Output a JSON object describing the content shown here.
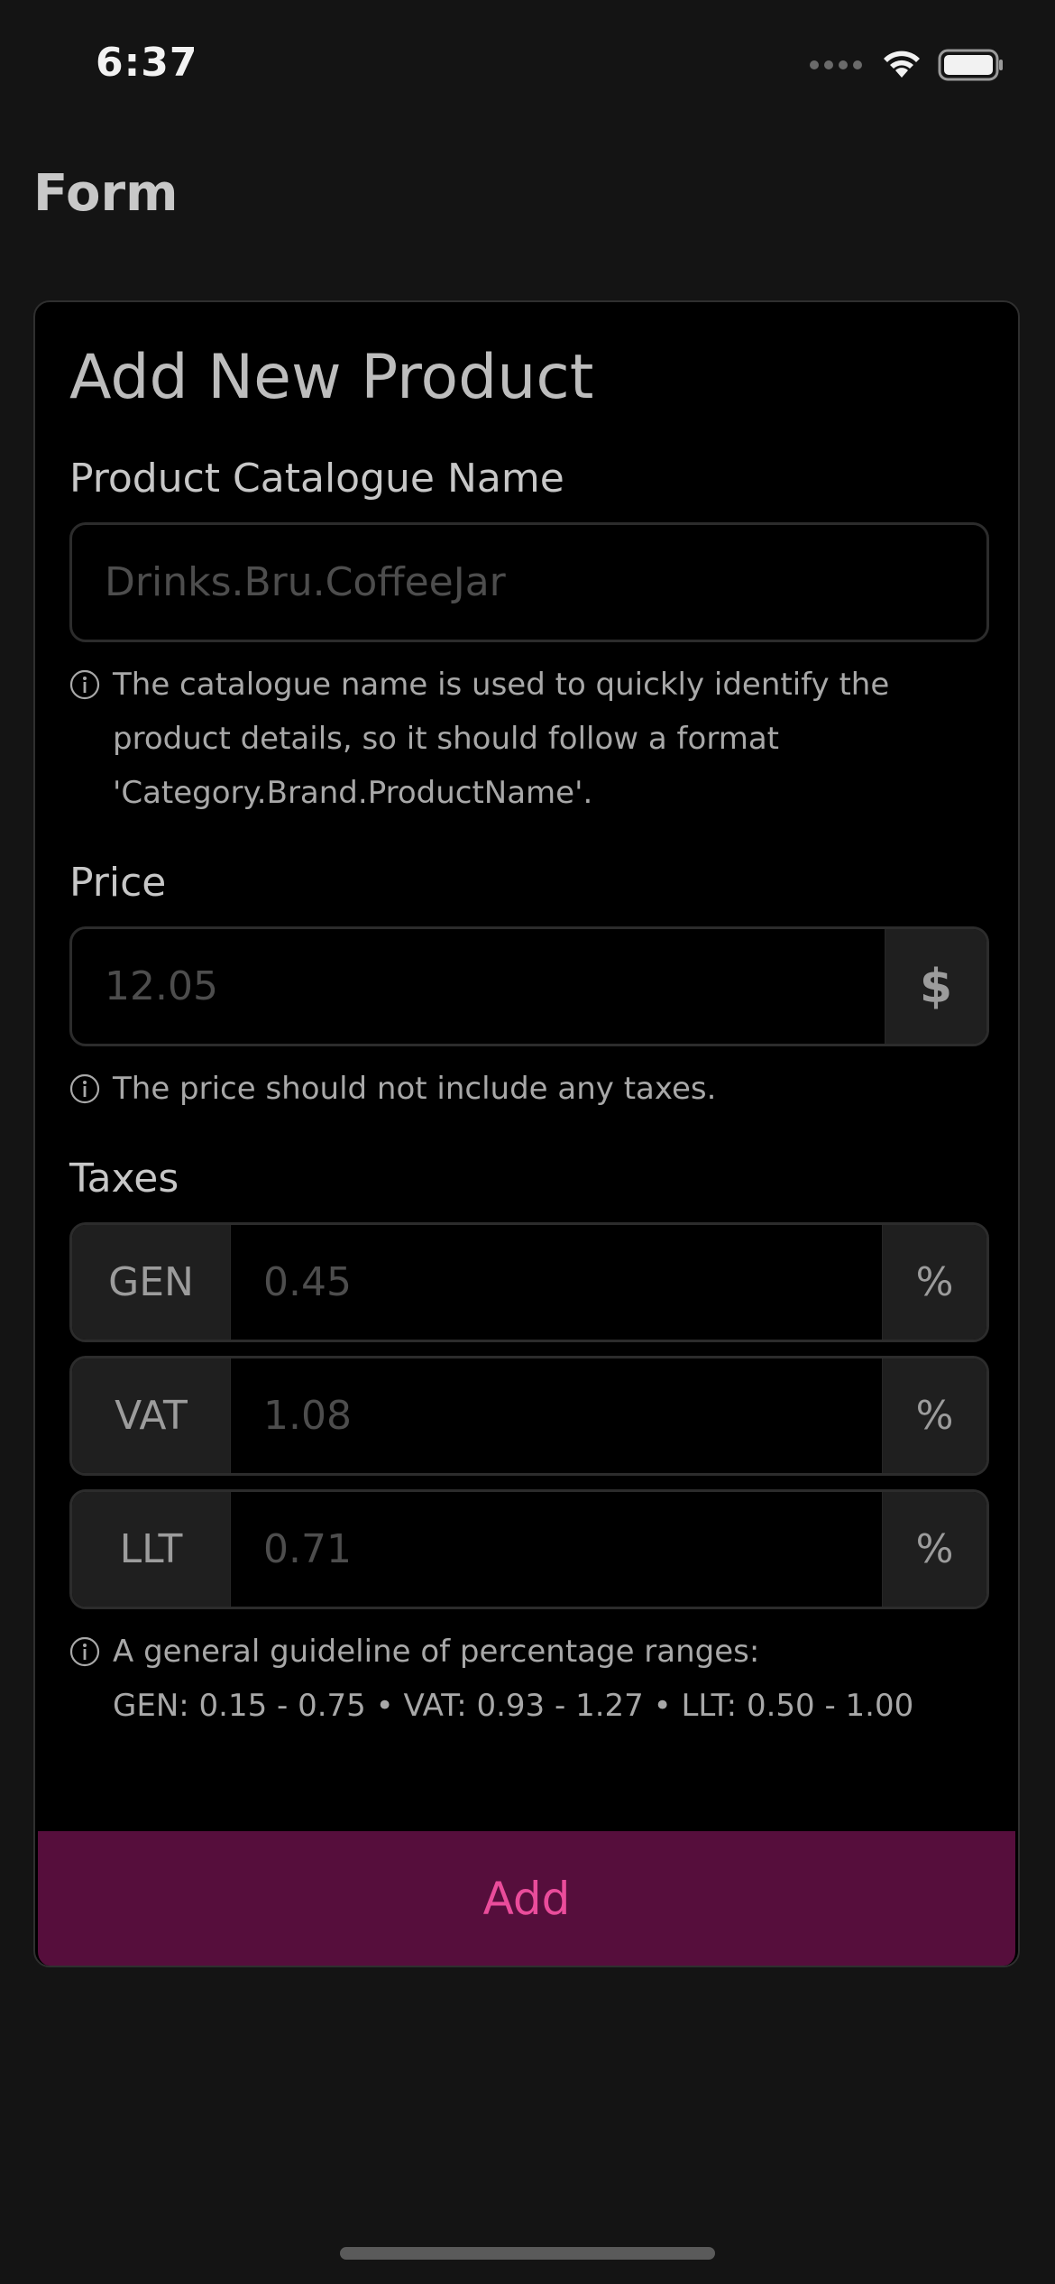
{
  "status_bar": {
    "time": "6:37",
    "icons": [
      "signal-icon",
      "wifi-icon",
      "battery-icon"
    ]
  },
  "navigation": {
    "title": "Form"
  },
  "form": {
    "title": "Add New Product",
    "catalogue": {
      "label": "Product Catalogue Name",
      "placeholder": "Drinks.Bru.CoffeeJar",
      "hint_lines": [
        "The catalogue name is used to quickly identify the",
        "product details, so it should follow a format",
        "'Category.Brand.ProductName'."
      ]
    },
    "price": {
      "label": "Price",
      "placeholder": "12.05",
      "currency": "$",
      "hint": "The price should not include any taxes."
    },
    "taxes": {
      "label": "Taxes",
      "rows": [
        {
          "code": "GEN",
          "placeholder": "0.45",
          "unit": "%"
        },
        {
          "code": "VAT",
          "placeholder": "1.08",
          "unit": "%"
        },
        {
          "code": "LLT",
          "placeholder": "0.71",
          "unit": "%"
        }
      ],
      "hint_lines": [
        "A general guideline of percentage ranges:",
        "GEN: 0.15 - 0.75 • VAT: 0.93 - 1.27 • LLT: 0.50 - 1.00"
      ]
    },
    "submit_label": "Add"
  },
  "colors": {
    "background": "#141414",
    "card": "#000000",
    "addon": "#1f1f1f",
    "button_background": "#560e3c",
    "button_text": "#ea4c9b"
  }
}
